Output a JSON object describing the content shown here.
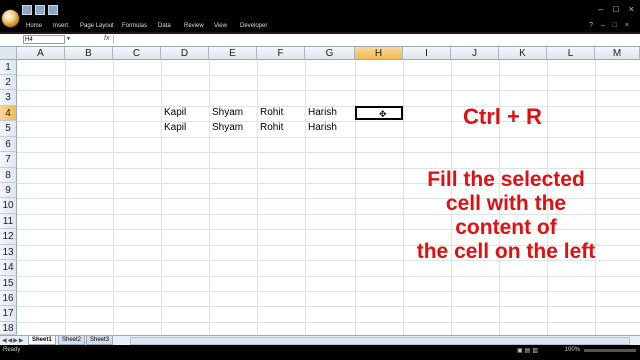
{
  "app": {
    "window_controls": [
      "–",
      "□",
      "×"
    ],
    "ribbon_tabs": [
      "Home",
      "Insert",
      "Page Layout",
      "Formulas",
      "Data",
      "Review",
      "View",
      "Developer"
    ],
    "ribbon_right": "? – □ ×"
  },
  "formula_bar": {
    "name_box": "H4",
    "fx_label": "fx",
    "formula": ""
  },
  "grid": {
    "columns": [
      "A",
      "B",
      "C",
      "D",
      "E",
      "F",
      "G",
      "H",
      "I",
      "J",
      "K",
      "L",
      "M"
    ],
    "selected_column": "H",
    "rows": [
      "1",
      "2",
      "3",
      "4",
      "5",
      "6",
      "7",
      "8",
      "9",
      "10",
      "11",
      "12",
      "13",
      "14",
      "15",
      "16",
      "17",
      "18"
    ],
    "selected_row": "4",
    "row4": {
      "D": "Kapil",
      "E": "Shyam",
      "F": "Rohit",
      "G": "Harish"
    },
    "row5": {
      "D": "Kapil",
      "E": "Shyam",
      "F": "Rohit",
      "G": "Harish"
    },
    "active_cell": "H4"
  },
  "overlay": {
    "shortcut": "Ctrl + R",
    "description": [
      "Fill the selected",
      "cell with the",
      "content of",
      "the cell on the left"
    ],
    "color": "#e01010"
  },
  "sheets": {
    "tabs": [
      "Sheet1",
      "Sheet2",
      "Sheet3"
    ],
    "active": "Sheet1"
  },
  "status": {
    "state": "Ready",
    "zoom": "100%"
  }
}
